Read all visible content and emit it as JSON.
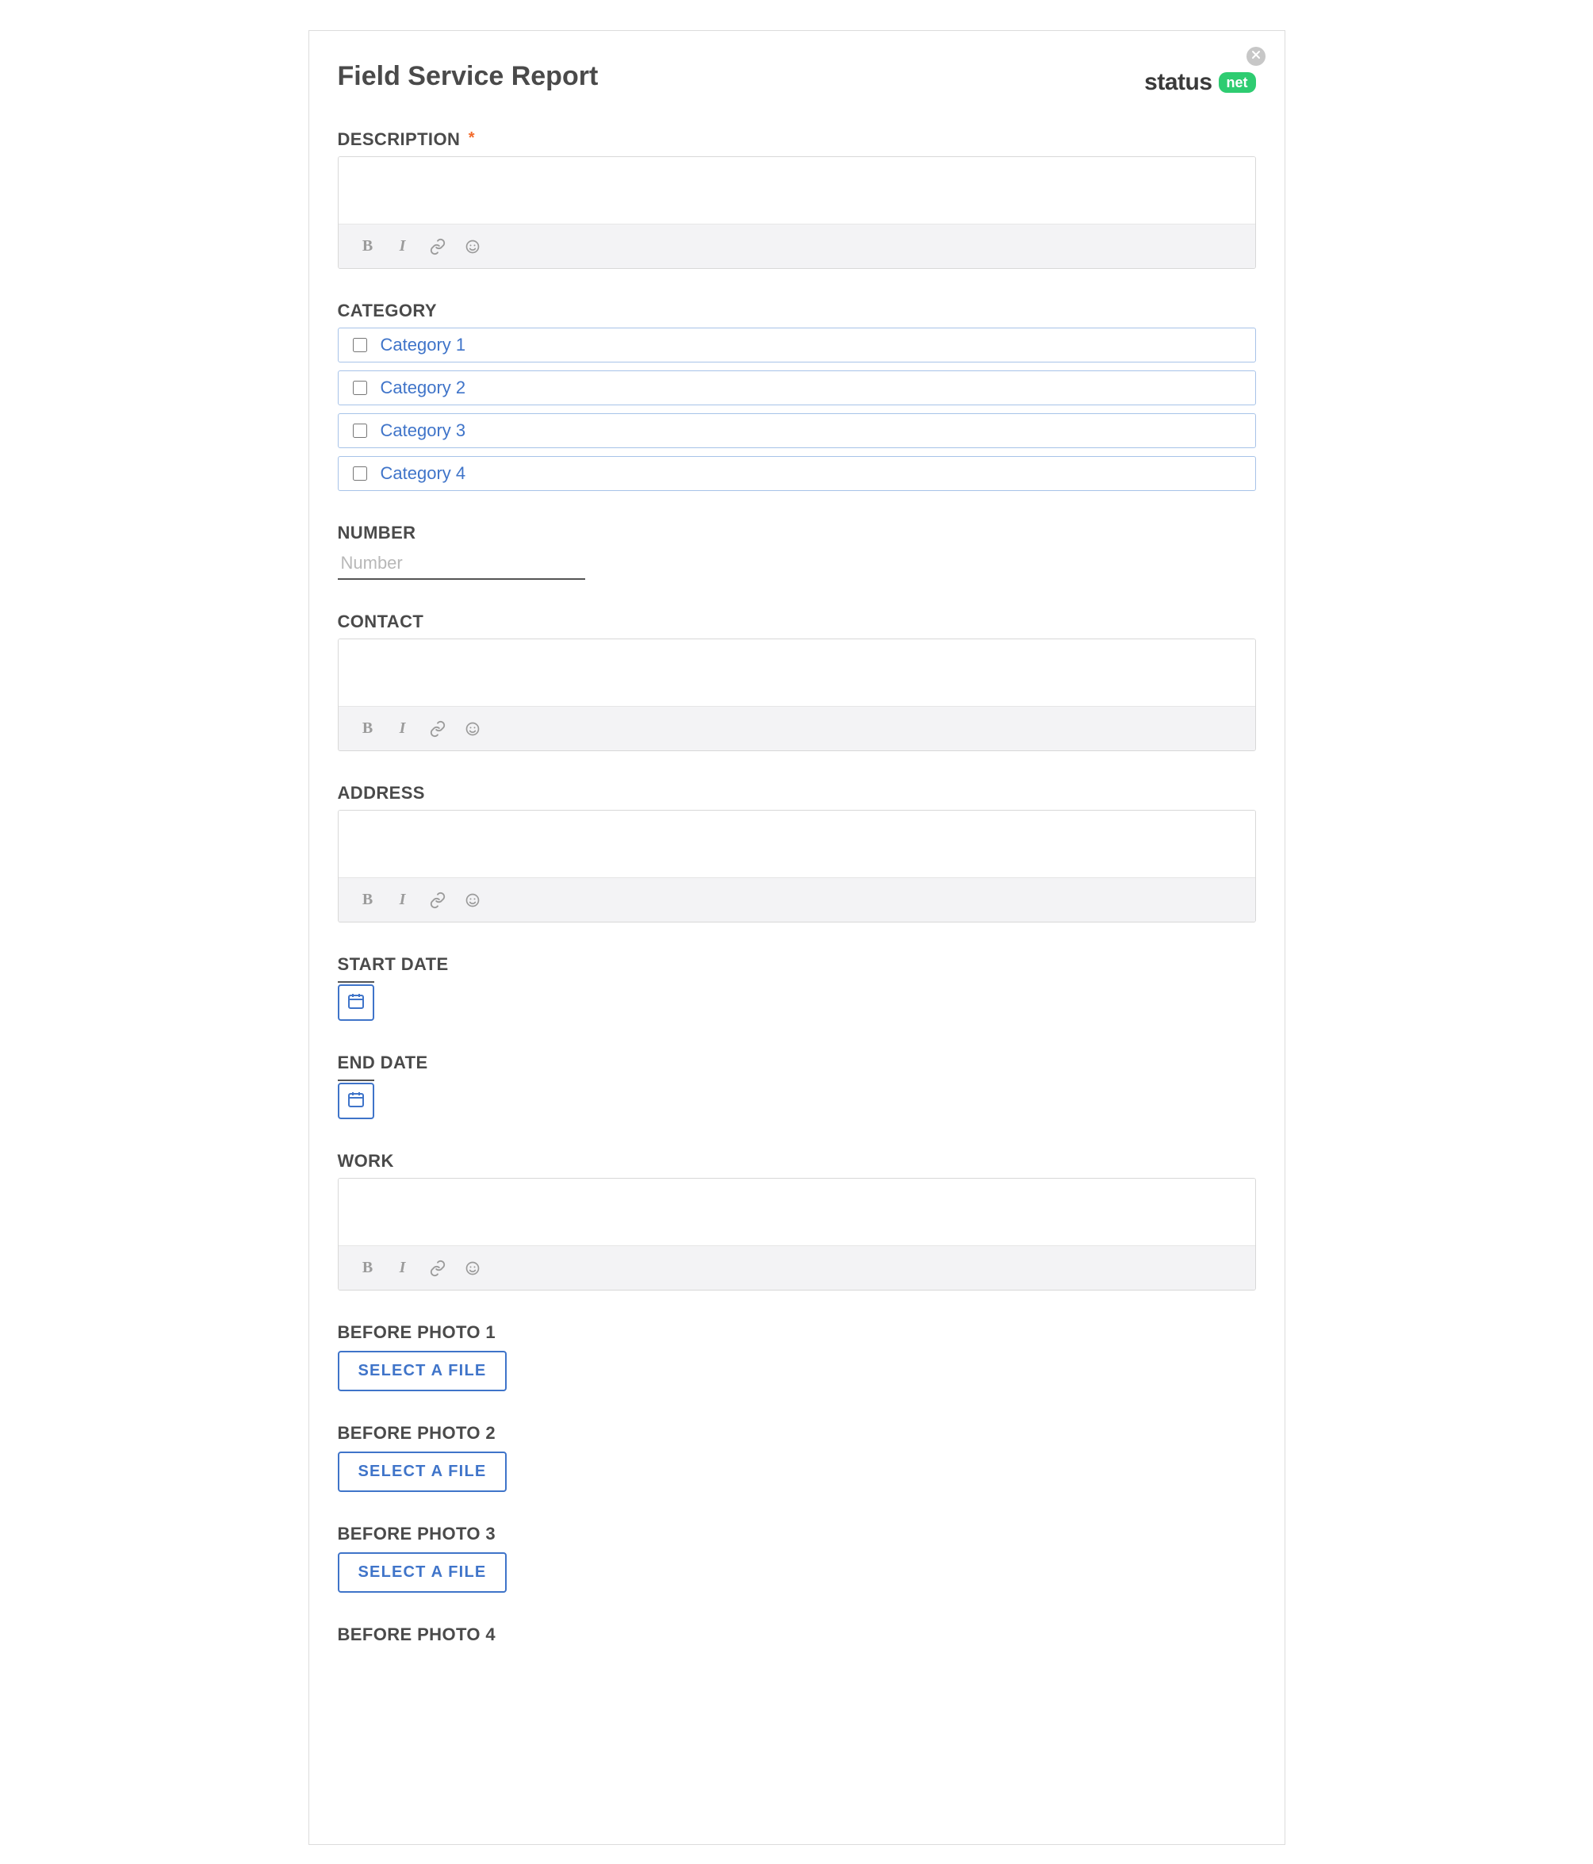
{
  "modal": {
    "title": "Field Service Report",
    "brand": {
      "word": "status",
      "badge": "net"
    }
  },
  "labels": {
    "description": "DESCRIPTION",
    "category": "CATEGORY",
    "number": "NUMBER",
    "contact": "CONTACT",
    "address": "ADDRESS",
    "start_date": "START DATE",
    "end_date": "END DATE",
    "work": "WORK",
    "before_photo_1": "BEFORE PHOTO 1",
    "before_photo_2": "BEFORE PHOTO 2",
    "before_photo_3": "BEFORE PHOTO 3",
    "before_photo_4": "BEFORE PHOTO 4"
  },
  "placeholders": {
    "number": "Number"
  },
  "categories": [
    {
      "label": "Category 1",
      "checked": false
    },
    {
      "label": "Category 2",
      "checked": false
    },
    {
      "label": "Category 3",
      "checked": false
    },
    {
      "label": "Category 4",
      "checked": false
    }
  ],
  "buttons": {
    "select_file": "SELECT A FILE"
  },
  "required_marker": "*"
}
